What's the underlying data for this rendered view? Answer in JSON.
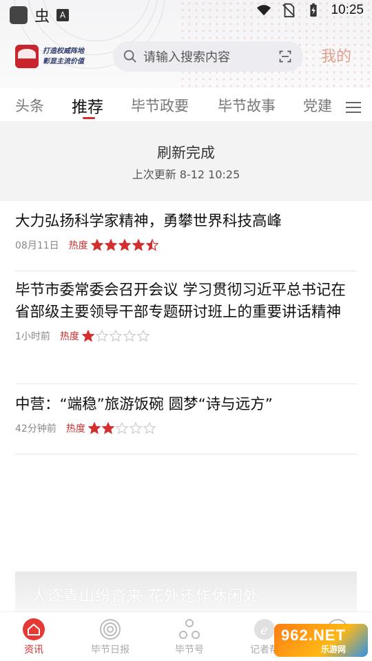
{
  "status_bar": {
    "time": "10:25",
    "a_badge": "A",
    "bug_glyph": "虫"
  },
  "header": {
    "logo_line1": "打造权威阵地",
    "logo_line2": "彰显主流价值",
    "search_placeholder": "请输入搜索内容",
    "mine_label": "我的"
  },
  "tabs": [
    "头条",
    "推荐",
    "毕节政要",
    "毕节故事",
    "党建"
  ],
  "active_tab": "推荐",
  "refresh": {
    "title": "刷新完成",
    "subtitle": "上次更新 8-12 10:25"
  },
  "heat_label": "热度",
  "news": [
    {
      "title": "大力弘扬科学家精神，勇攀世界科技高峰",
      "time": "08月11日",
      "rating": 4.5
    },
    {
      "title": "毕节市委常委会召开会议 学习贯彻习近平总书记在省部级主要领导干部专题研讨班上的重要讲话精神",
      "time": "1小时前",
      "rating": 1
    },
    {
      "title": "中营：“端稳”旅游饭碗 圆梦“诗与远方”",
      "time": "42分钟前",
      "rating": 2
    }
  ],
  "banner_text": "人逐青山纷沓来 花外还作休闲处",
  "bottom_nav": [
    {
      "label": "资讯",
      "icon": "home-icon",
      "active": true
    },
    {
      "label": "毕节日报",
      "icon": "newspaper-icon",
      "active": false
    },
    {
      "label": "毕节号",
      "icon": "network-icon",
      "active": false
    },
    {
      "label": "记者帮",
      "icon": "e-icon",
      "active": false
    },
    {
      "label": "",
      "icon": "circle-icon",
      "active": false
    }
  ],
  "watermark": {
    "main": "962.NET",
    "sub": "乐游网"
  },
  "colors": {
    "accent": "#d32f2f",
    "star": "#d32f2f",
    "star_empty": "#cccccc"
  }
}
